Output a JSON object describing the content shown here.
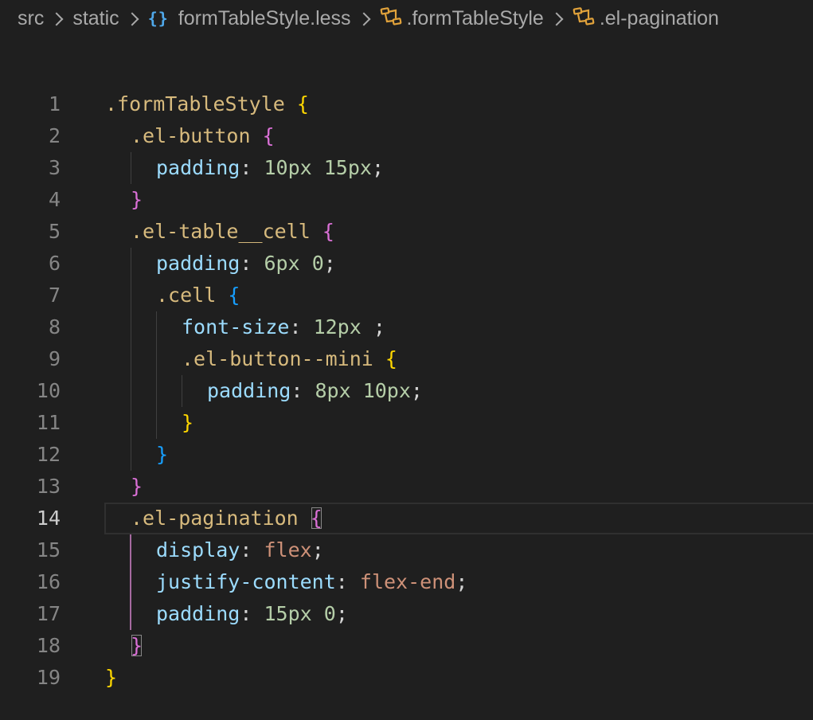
{
  "breadcrumb": {
    "items": [
      "src",
      "static",
      "formTableStyle.less",
      ".formTableStyle",
      ".el-pagination"
    ]
  },
  "colors": {
    "background": "#1f1f1f",
    "selector": "#d7ba7d",
    "property": "#9cdcfe",
    "number": "#b5cea8",
    "keyword_value": "#ce9178",
    "bracket_level1": "#ffd700",
    "bracket_level2": "#da70d6",
    "bracket_level3": "#179fff"
  },
  "editor": {
    "current_line": 14,
    "lines": [
      {
        "n": "1",
        "indent": 0,
        "tokens": [
          {
            "t": ".formTableStyle",
            "c": "sel"
          },
          {
            "t": " ",
            "c": "punc"
          },
          {
            "t": "{",
            "c": "b1"
          }
        ]
      },
      {
        "n": "2",
        "indent": 1,
        "tokens": [
          {
            "t": ".el-button",
            "c": "sel"
          },
          {
            "t": " ",
            "c": "punc"
          },
          {
            "t": "{",
            "c": "b2"
          }
        ]
      },
      {
        "n": "3",
        "indent": 2,
        "tokens": [
          {
            "t": "padding",
            "c": "prop"
          },
          {
            "t": ": ",
            "c": "punc"
          },
          {
            "t": "10px",
            "c": "num"
          },
          {
            "t": " ",
            "c": "punc"
          },
          {
            "t": "15px",
            "c": "num"
          },
          {
            "t": ";",
            "c": "punc"
          }
        ]
      },
      {
        "n": "4",
        "indent": 1,
        "tokens": [
          {
            "t": "}",
            "c": "b2"
          }
        ]
      },
      {
        "n": "5",
        "indent": 1,
        "tokens": [
          {
            "t": ".el-table__cell",
            "c": "sel"
          },
          {
            "t": " ",
            "c": "punc"
          },
          {
            "t": "{",
            "c": "b2"
          }
        ]
      },
      {
        "n": "6",
        "indent": 2,
        "tokens": [
          {
            "t": "padding",
            "c": "prop"
          },
          {
            "t": ": ",
            "c": "punc"
          },
          {
            "t": "6px",
            "c": "num"
          },
          {
            "t": " ",
            "c": "punc"
          },
          {
            "t": "0",
            "c": "num"
          },
          {
            "t": ";",
            "c": "punc"
          }
        ]
      },
      {
        "n": "7",
        "indent": 2,
        "tokens": [
          {
            "t": ".cell",
            "c": "sel"
          },
          {
            "t": " ",
            "c": "punc"
          },
          {
            "t": "{",
            "c": "b3"
          }
        ]
      },
      {
        "n": "8",
        "indent": 3,
        "tokens": [
          {
            "t": "font-size",
            "c": "prop"
          },
          {
            "t": ": ",
            "c": "punc"
          },
          {
            "t": "12px",
            "c": "num"
          },
          {
            "t": " ;",
            "c": "punc"
          }
        ]
      },
      {
        "n": "9",
        "indent": 3,
        "tokens": [
          {
            "t": ".el-button--mini",
            "c": "sel"
          },
          {
            "t": " ",
            "c": "punc"
          },
          {
            "t": "{",
            "c": "b1"
          }
        ]
      },
      {
        "n": "10",
        "indent": 4,
        "tokens": [
          {
            "t": "padding",
            "c": "prop"
          },
          {
            "t": ": ",
            "c": "punc"
          },
          {
            "t": "8px",
            "c": "num"
          },
          {
            "t": " ",
            "c": "punc"
          },
          {
            "t": "10px",
            "c": "num"
          },
          {
            "t": ";",
            "c": "punc"
          }
        ]
      },
      {
        "n": "11",
        "indent": 3,
        "tokens": [
          {
            "t": "}",
            "c": "b1"
          }
        ]
      },
      {
        "n": "12",
        "indent": 2,
        "tokens": [
          {
            "t": "}",
            "c": "b3"
          }
        ]
      },
      {
        "n": "13",
        "indent": 1,
        "tokens": [
          {
            "t": "}",
            "c": "b2"
          }
        ]
      },
      {
        "n": "14",
        "indent": 1,
        "tokens": [
          {
            "t": ".el-pagination",
            "c": "sel"
          },
          {
            "t": " ",
            "c": "punc"
          },
          {
            "t": "{",
            "c": "b2 bm"
          }
        ]
      },
      {
        "n": "15",
        "indent": 2,
        "tokens": [
          {
            "t": "display",
            "c": "prop"
          },
          {
            "t": ": ",
            "c": "punc"
          },
          {
            "t": "flex",
            "c": "kw"
          },
          {
            "t": ";",
            "c": "punc"
          }
        ]
      },
      {
        "n": "16",
        "indent": 2,
        "tokens": [
          {
            "t": "justify-content",
            "c": "prop"
          },
          {
            "t": ": ",
            "c": "punc"
          },
          {
            "t": "flex-end",
            "c": "kw"
          },
          {
            "t": ";",
            "c": "punc"
          }
        ]
      },
      {
        "n": "17",
        "indent": 2,
        "tokens": [
          {
            "t": "padding",
            "c": "prop"
          },
          {
            "t": ": ",
            "c": "punc"
          },
          {
            "t": "15px",
            "c": "num"
          },
          {
            "t": " ",
            "c": "punc"
          },
          {
            "t": "0",
            "c": "num"
          },
          {
            "t": ";",
            "c": "punc"
          }
        ]
      },
      {
        "n": "18",
        "indent": 1,
        "tokens": [
          {
            "t": "}",
            "c": "b2 bm"
          }
        ]
      },
      {
        "n": "19",
        "indent": 0,
        "tokens": [
          {
            "t": "}",
            "c": "b1"
          }
        ]
      }
    ]
  }
}
